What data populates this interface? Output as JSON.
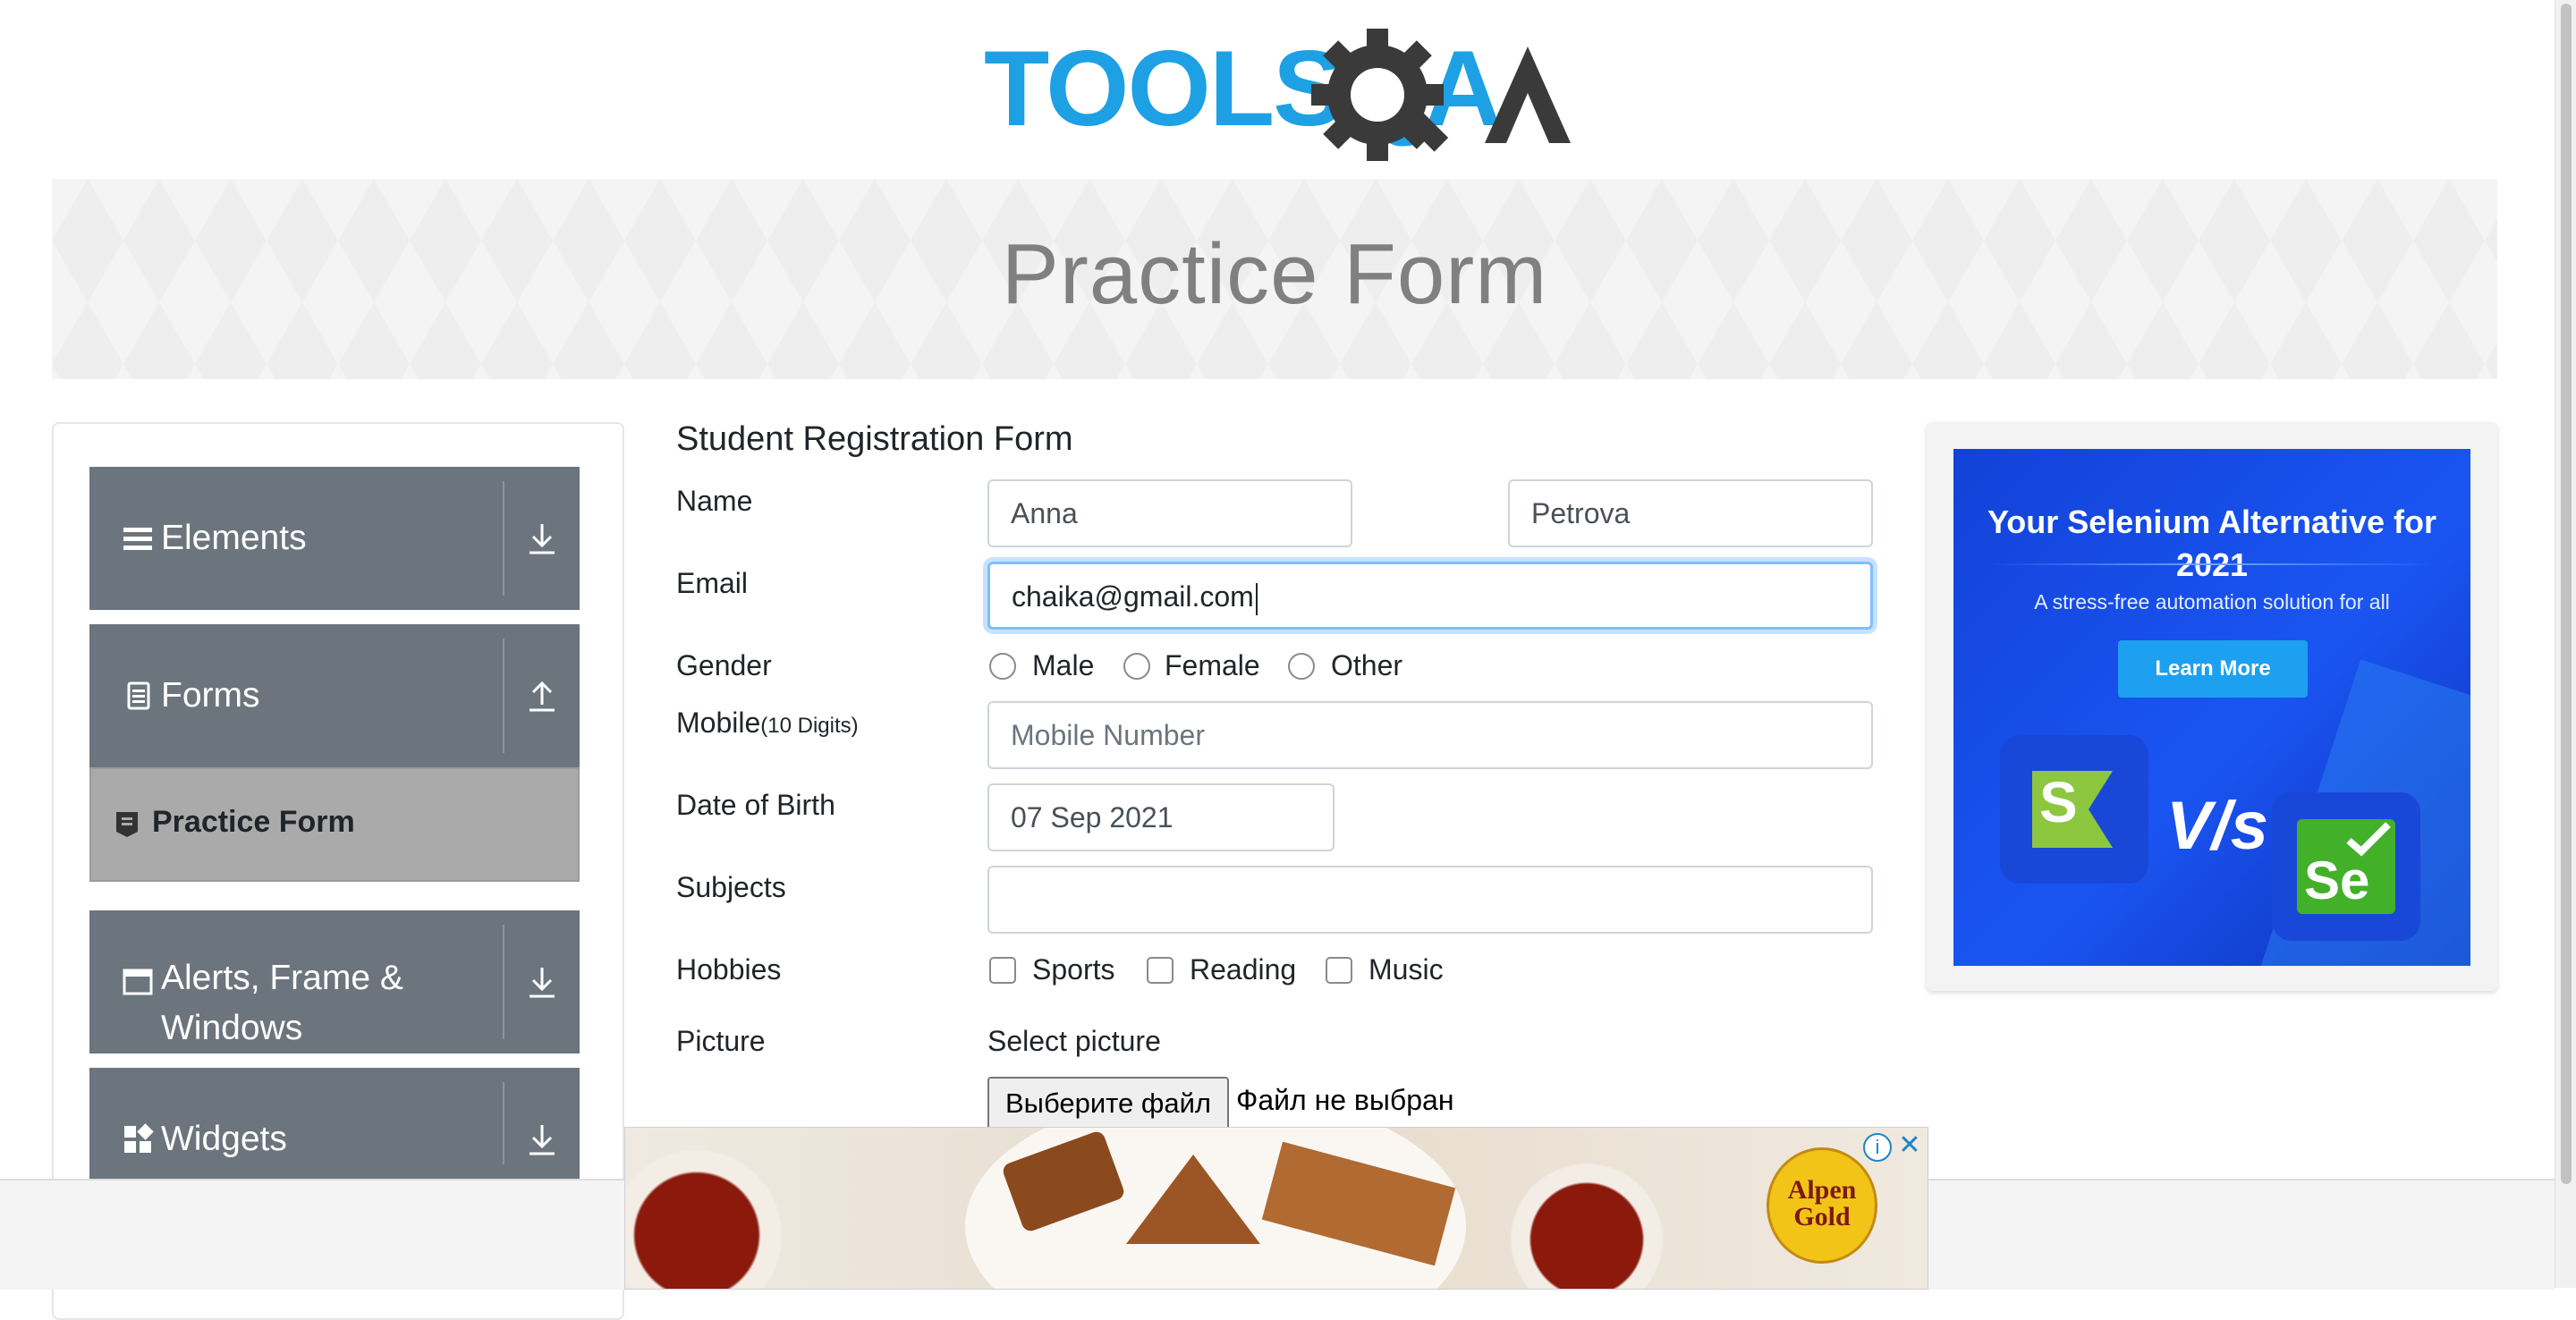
{
  "header": {
    "logo_text": "TOOLSQA"
  },
  "banner": {
    "title": "Practice Form"
  },
  "sidebar": {
    "groups": [
      {
        "label": "Elements",
        "icon": "hamburger-icon",
        "arrow": "download-arrow-icon"
      },
      {
        "label": "Forms",
        "icon": "document-icon",
        "arrow": "upload-arrow-icon"
      },
      {
        "label_line1": "Alerts, Frame &",
        "label_line2": "Windows",
        "icon": "window-icon",
        "arrow": "download-arrow-icon"
      },
      {
        "label": "Widgets",
        "icon": "widgets-icon",
        "arrow": "download-arrow-icon"
      }
    ],
    "active_item": {
      "label": "Practice Form",
      "icon": "form-doc-icon"
    }
  },
  "form": {
    "title": "Student Registration Form",
    "name_label": "Name",
    "first_name_value": "Anna",
    "last_name_value": "Petrova",
    "email_label": "Email",
    "email_value": "chaika@gmail.com",
    "gender_label": "Gender",
    "gender_options": [
      "Male",
      "Female",
      "Other"
    ],
    "mobile_label": "Mobile",
    "mobile_hint": "(10 Digits)",
    "mobile_placeholder": "Mobile Number",
    "dob_label": "Date of Birth",
    "dob_value": "07 Sep 2021",
    "subjects_label": "Subjects",
    "hobbies_label": "Hobbies",
    "hobby_options": [
      "Sports",
      "Reading",
      "Music"
    ],
    "picture_label": "Picture",
    "select_picture": "Select picture",
    "file_button": "Выберите файл",
    "file_status": "Файл не выбран"
  },
  "right_ad": {
    "headline": "Your Selenium Alternative for 2021",
    "subline": "A stress-free automation solution for all",
    "button": "Learn More",
    "vs_text": "V/s",
    "se_text": "Se"
  },
  "bottom_ad": {
    "brand": "Alpen Gold",
    "info": "i",
    "close": "✕"
  },
  "colors": {
    "sidebar_group": "#6c757d",
    "sidebar_active": "#aaaaaa",
    "logo_blue": "#1da1e4",
    "logo_dark": "#3a3a3a",
    "focus_border": "#80bdff",
    "ad_blue": "#1a55f2"
  }
}
